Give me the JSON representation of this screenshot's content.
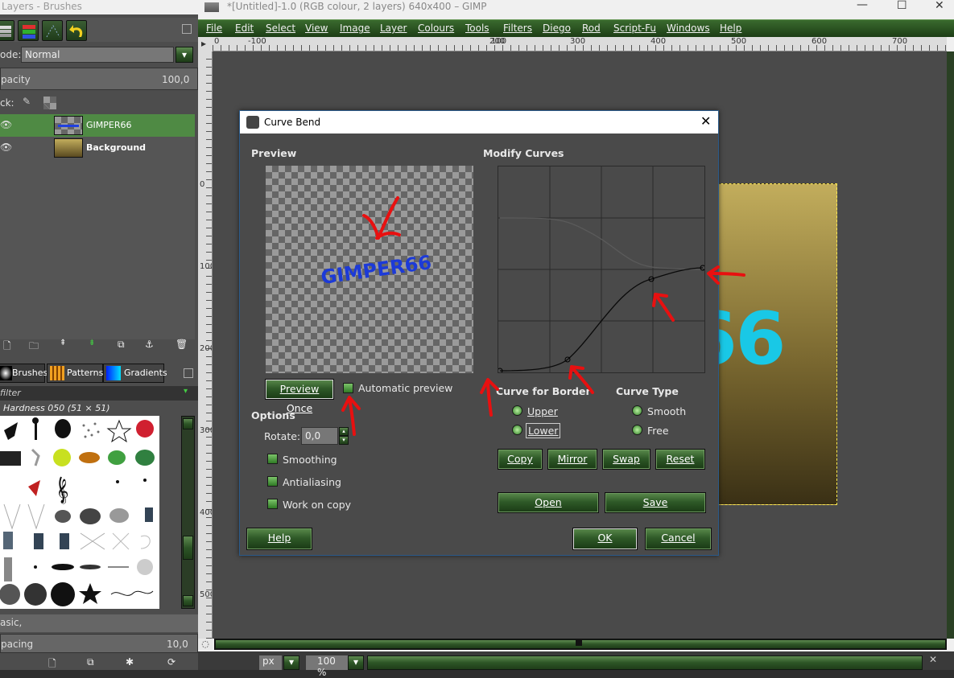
{
  "dock": {
    "title": "Layers - Brushes",
    "mode_label": "ode:",
    "mode_value": "Normal",
    "opacity_label": "pacity",
    "opacity_value": "100,0",
    "lock_label": "ck:",
    "layers": [
      {
        "name": "GIMPER66",
        "selected": true
      },
      {
        "name": "Background",
        "selected": false
      }
    ],
    "tabs": [
      "Brushes",
      "Patterns",
      "Gradients"
    ],
    "filter_label": "filter",
    "brush_name": "Hardness 050 (51 × 51)",
    "preset_text": "asic,",
    "spacing_label": "pacing",
    "spacing_value": "10,0"
  },
  "window": {
    "title": "*[Untitled]-1.0 (RGB colour, 2 layers) 640x400 – GIMP",
    "menus": [
      "File",
      "Edit",
      "Select",
      "View",
      "Image",
      "Layer",
      "Colours",
      "Tools",
      "Filters",
      "Diego",
      "Rod",
      "Script-Fu",
      "Windows",
      "Help"
    ],
    "ruler_h": [
      "-100",
      "100",
      "200",
      "300",
      "400",
      "500",
      "600",
      "700"
    ],
    "ruler_h_lead": "0",
    "ruler_v": [
      "0",
      "100",
      "200",
      "300",
      "400",
      "500"
    ],
    "canvas_text": "66",
    "status_unit": "px",
    "status_zoom": "100 %"
  },
  "dialog": {
    "title": "Curve Bend",
    "preview_heading": "Preview",
    "preview_text": "GIMPER66",
    "preview_once": "Preview Once",
    "auto_preview": "Automatic preview",
    "options_heading": "Options",
    "rotate_label": "Rotate:",
    "rotate_value": "0,0",
    "smoothing": "Smoothing",
    "antialiasing": "Antialiasing",
    "work_on_copy": "Work on copy",
    "modify_heading": "Modify Curves",
    "curve_border_heading": "Curve for Border",
    "upper": "Upper",
    "lower": "Lower",
    "curve_type_heading": "Curve Type",
    "smooth": "Smooth",
    "free": "Free",
    "copy": "Copy",
    "mirror": "Mirror",
    "swap": "Swap",
    "reset": "Reset",
    "open": "Open",
    "save": "Save",
    "help": "Help",
    "ok": "OK",
    "cancel": "Cancel"
  },
  "colors": {
    "accent_green": "#2f5a28",
    "canvas_text": "#19c8e6",
    "annotation_red": "#e81010"
  }
}
